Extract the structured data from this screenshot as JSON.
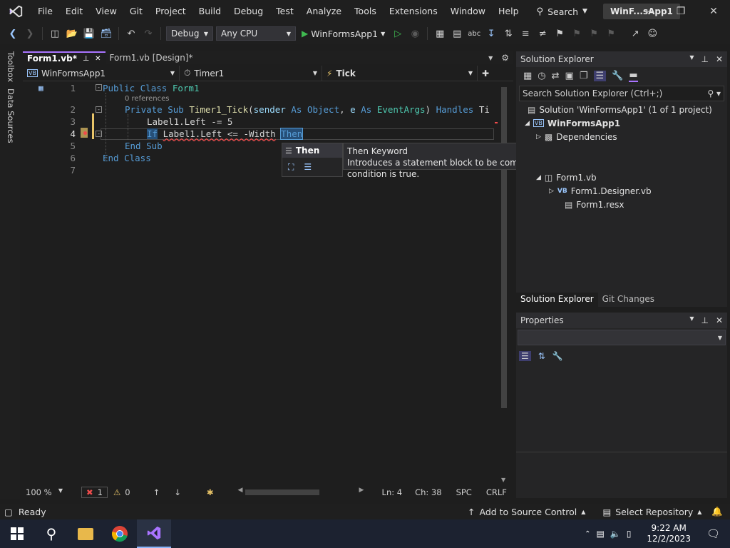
{
  "app": {
    "menus": [
      "File",
      "Edit",
      "View",
      "Git",
      "Project",
      "Build",
      "Debug",
      "Test",
      "Analyze",
      "Tools",
      "Extensions",
      "Window",
      "Help"
    ],
    "search_label": "Search",
    "solution_badge": "WinF...sApp1"
  },
  "toolbar": {
    "config": "Debug",
    "platform": "Any CPU",
    "run_target": "WinFormsApp1"
  },
  "left_rail": {
    "toolbox": "Toolbox",
    "data_sources": "Data Sources"
  },
  "tabs": [
    {
      "label": "Form1.vb*",
      "active": true
    },
    {
      "label": "Form1.vb [Design]*",
      "active": false
    }
  ],
  "nav": {
    "project": "WinFormsApp1",
    "object": "Timer1",
    "member": "Tick"
  },
  "code": {
    "line_numbers": [
      "1",
      "2",
      "3",
      "4",
      "5",
      "6",
      "7"
    ],
    "codelens": "0 references",
    "l1_kw": "Public Class",
    "l1_name": "Form1",
    "l2_mod": "Private Sub",
    "l2_fn": "Timer1_Tick",
    "l2_p1": "sender",
    "l2_as1": "As",
    "l2_t1": "Object",
    "l2_p2": "e",
    "l2_as2": "As",
    "l2_t2": "EventArgs",
    "l2_handles": "Handles",
    "l2_tail": "Ti",
    "l3": "Label1.Left -= 5",
    "l4_if": "If",
    "l4_body": "Label1.Left <= -Width",
    "l4_then": "Then",
    "l5": "End Sub",
    "l6": "End Class"
  },
  "completion": {
    "item": "Then"
  },
  "tooltip": {
    "title": "Then Keyword",
    "description": "Introduces a statement block to be compiled or executed if a tested condition is true."
  },
  "editor_status": {
    "zoom": "100 %",
    "errors": "1",
    "warnings": "0",
    "line": "Ln: 4",
    "char": "Ch: 38",
    "spacing": "SPC",
    "eol": "CRLF"
  },
  "solution_explorer": {
    "title": "Solution Explorer",
    "search_placeholder": "Search Solution Explorer (Ctrl+;)",
    "solution": "Solution 'WinFormsApp1' (1 of 1 project)",
    "project": "WinFormsApp1",
    "dependencies": "Dependencies",
    "form": "Form1.vb",
    "designer": "Form1.Designer.vb",
    "resx": "Form1.resx",
    "tabs": [
      "Solution Explorer",
      "Git Changes"
    ]
  },
  "properties": {
    "title": "Properties"
  },
  "statusbar": {
    "ready": "Ready",
    "source_control": "Add to Source Control",
    "repository": "Select Repository"
  },
  "taskbar": {
    "time": "9:22 AM",
    "date": "12/2/2023"
  },
  "colors": {
    "accent": "#a974ff",
    "keyword": "#569cd6",
    "type": "#4ec9b0",
    "function": "#dcdcaa",
    "parameter": "#9cdcfe",
    "number": "#b5cea8",
    "error": "#f14c4c"
  }
}
